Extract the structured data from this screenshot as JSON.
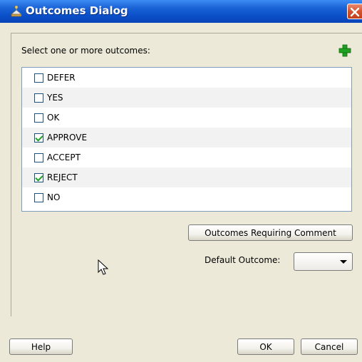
{
  "window": {
    "title": "Outcomes Dialog"
  },
  "content": {
    "select_label": "Select one or more outcomes:",
    "outcomes": [
      {
        "label": "DEFER",
        "checked": false
      },
      {
        "label": "YES",
        "checked": false
      },
      {
        "label": "OK",
        "checked": false
      },
      {
        "label": "APPROVE",
        "checked": true
      },
      {
        "label": "ACCEPT",
        "checked": false
      },
      {
        "label": "REJECT",
        "checked": true
      },
      {
        "label": "NO",
        "checked": false
      }
    ],
    "outcomes_requiring_comment_label": "Outcomes Requiring Comment",
    "default_outcome_label": "Default Outcome:",
    "default_outcome_value": ""
  },
  "buttons": {
    "help": "Help",
    "ok": "OK",
    "cancel": "Cancel"
  },
  "icons": {
    "title": "app-icon",
    "close": "close-icon",
    "add": "plus-icon",
    "cursor": "mouse-pointer-icon"
  },
  "colors": {
    "titlebar": "#0a4fc8",
    "add_icon": "#21a121",
    "check": "#21a121",
    "close": "#d4522e"
  }
}
